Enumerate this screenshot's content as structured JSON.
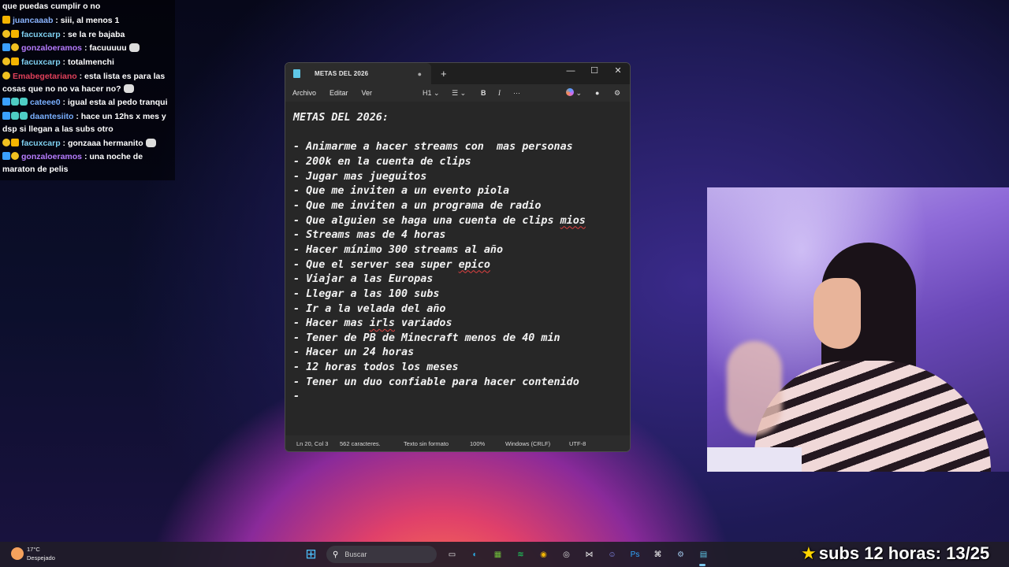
{
  "chat": {
    "messages": [
      {
        "user": "",
        "user_color": "#ffffff",
        "text": "que puedas cumplir o no",
        "badges": []
      },
      {
        "user": "juancaaab",
        "user_color": "#8ab4ff",
        "text": ": siii, al menos 1",
        "badges": [
          "vip"
        ]
      },
      {
        "user": "facuxcarp",
        "user_color": "#7fd0f0",
        "text": ": se la re bajaba",
        "badges": [
          "star",
          "vip"
        ]
      },
      {
        "user": "gonzaloeramos",
        "user_color": "#b77cff",
        "text": ": facuuuuu",
        "badges": [
          "mod",
          "star"
        ],
        "emote": true
      },
      {
        "user": "facuxcarp",
        "user_color": "#7fd0f0",
        "text": ": totalmenchi",
        "badges": [
          "star",
          "vip"
        ]
      },
      {
        "user": "Emabegetariano",
        "user_color": "#e0405a",
        "text": ": esta lista es para las cosas que no no va hacer no?",
        "badges": [
          "star"
        ],
        "emote": true
      },
      {
        "user": "cateee0",
        "user_color": "#7ab0ff",
        "text": ": igual esta al pedo tranqui",
        "badges": [
          "mod",
          "sub",
          "sub"
        ]
      },
      {
        "user": "daantesiito",
        "user_color": "#7ab0ff",
        "text": ": hace un 12hs x mes y dsp si llegan a las subs otro",
        "badges": [
          "mod",
          "sub",
          "sub"
        ]
      },
      {
        "user": "facuxcarp",
        "user_color": "#7fd0f0",
        "text": ": gonzaaa hermanito",
        "badges": [
          "star",
          "vip"
        ],
        "emote": true
      },
      {
        "user": "gonzaloeramos",
        "user_color": "#b77cff",
        "text": ": una noche de maraton de pelis",
        "badges": [
          "mod",
          "star"
        ]
      }
    ]
  },
  "notepad": {
    "tab_title": "METAS DEL 2026",
    "tab_modified": "●",
    "new_tab": "+",
    "window_controls": {
      "minimize": "—",
      "maximize": "☐",
      "close": "✕"
    },
    "menu": [
      "Archivo",
      "Editar",
      "Ver"
    ],
    "toolbar": {
      "heading": "H1",
      "heading_chevron": "⌄",
      "list": "☰",
      "list_chevron": "⌄",
      "bold": "B",
      "italic": "I",
      "more": "···",
      "copilot_chevron": "⌄",
      "profile": "●",
      "settings": "⚙"
    },
    "content_lines": [
      "METAS DEL 2026:",
      "",
      "- Animarme a hacer streams con  mas personas",
      "- 200k en la cuenta de clips",
      "- Jugar mas jueguitos",
      "- Que me inviten a un evento piola",
      "- Que me inviten a un programa de radio",
      "- Que alguien se haga una cuenta de clips mios",
      "- Streams mas de 4 horas",
      "- Hacer mínimo 300 streams al año",
      "- Que el server sea super epico",
      "- Viajar a las Europas",
      "- Llegar a las 100 subs",
      "- Ir a la velada del año",
      "- Hacer mas irls variados",
      "- Tener de PB de Minecraft menos de 40 min",
      "- Hacer un 24 horas",
      "- 12 horas todos los meses",
      "- Tener un duo confiable para hacer contenido",
      "-"
    ],
    "status": {
      "position": "Ln 20, Col 3",
      "chars": "562 caracteres.",
      "format": "Texto sin formato",
      "zoom": "100%",
      "line_endings": "Windows (CRLF)",
      "encoding": "UTF-8"
    }
  },
  "taskbar": {
    "weather_temp": "17°C",
    "weather_desc": "Despejado",
    "search_placeholder": "Buscar",
    "search_glass": "⚲",
    "start_glyph": "⊞",
    "apps": [
      {
        "name": "file-explorer-icon",
        "glyph": "▭",
        "color": "#e8e8e8"
      },
      {
        "name": "edge-icon",
        "glyph": "◐",
        "color": "#2bb0e8"
      },
      {
        "name": "minecraft-icon",
        "glyph": "▦",
        "color": "#6fbf3a"
      },
      {
        "name": "spotify-icon",
        "glyph": "≋",
        "color": "#1ed760"
      },
      {
        "name": "chrome-icon",
        "glyph": "◉",
        "color": "#f2b705"
      },
      {
        "name": "obs-icon",
        "glyph": "◎",
        "color": "#ddd"
      },
      {
        "name": "capcut-icon",
        "glyph": "⋈",
        "color": "#eee"
      },
      {
        "name": "discord-icon",
        "glyph": "☺",
        "color": "#8a95ff"
      },
      {
        "name": "photoshop-icon",
        "glyph": "Ps",
        "color": "#31a8ff"
      },
      {
        "name": "capcut-alt-icon",
        "glyph": "⌘",
        "color": "#fff"
      },
      {
        "name": "steam-icon",
        "glyph": "⚙",
        "color": "#9ec3e6"
      },
      {
        "name": "notepad-icon",
        "glyph": "▤",
        "color": "#5fc8e8"
      }
    ]
  },
  "overlay": {
    "star": "★",
    "subs_text": "subs 12 horas: 13/25"
  }
}
